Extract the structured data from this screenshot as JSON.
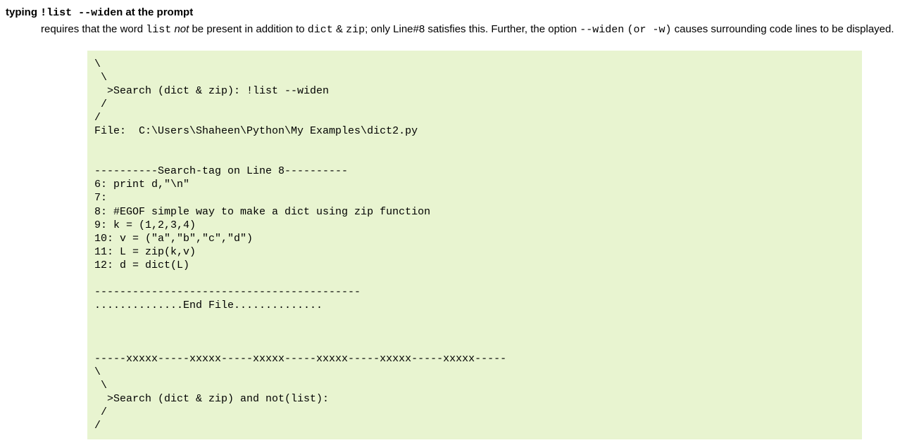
{
  "heading": {
    "prefix": "typing ",
    "code": "!list --widen",
    "suffix": " at the prompt"
  },
  "description": {
    "t1": "requires that the word ",
    "c1": "list",
    "t2": " ",
    "i1": "not",
    "t3": " be present in addition to ",
    "c2": "dict",
    "t4": " & ",
    "c3": "zip",
    "t5": "; only Line#8 satisfies this. Further, the option ",
    "c4": "--widen",
    "t6": " ",
    "c5": "(or -w)",
    "t7": " causes surrounding code lines to be displayed."
  },
  "code": "\\\n \\\n  >Search (dict & zip): !list --widen\n /\n/\nFile:  C:\\Users\\Shaheen\\Python\\My Examples\\dict2.py\n\n\n----------Search-tag on Line 8----------\n6: print d,\"\\n\"\n7:\n8: #EGOF simple way to make a dict using zip function\n9: k = (1,2,3,4)\n10: v = (\"a\",\"b\",\"c\",\"d\")\n11: L = zip(k,v)\n12: d = dict(L)\n\n------------------------------------------\n..............End File..............\n\n\n\n-----xxxxx-----xxxxx-----xxxxx-----xxxxx-----xxxxx-----xxxxx-----\n\\\n \\\n  >Search (dict & zip) and not(list):\n /\n/"
}
